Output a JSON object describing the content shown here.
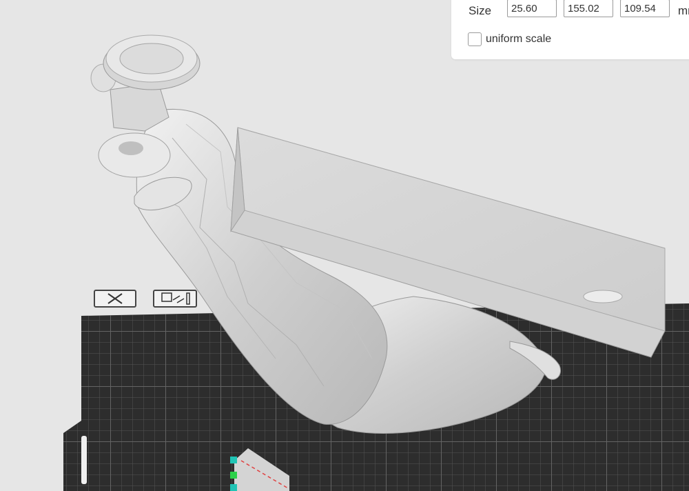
{
  "size_panel": {
    "label": "Size",
    "x_value": "25.60",
    "y_value": "155.02",
    "z_value": "109.54",
    "unit": "mm",
    "uniform_scale_label": "uniform scale",
    "uniform_scale_checked": false
  },
  "plate_toolbar": {
    "icons": [
      "delete-plate-icon",
      "arrange-plate-icon"
    ]
  },
  "colors": {
    "background": "#e6e6e6",
    "plate": "#2e2e2e",
    "grid": "#5a5a5a",
    "model": "#d9d9d9",
    "accent": "#00bfae"
  }
}
